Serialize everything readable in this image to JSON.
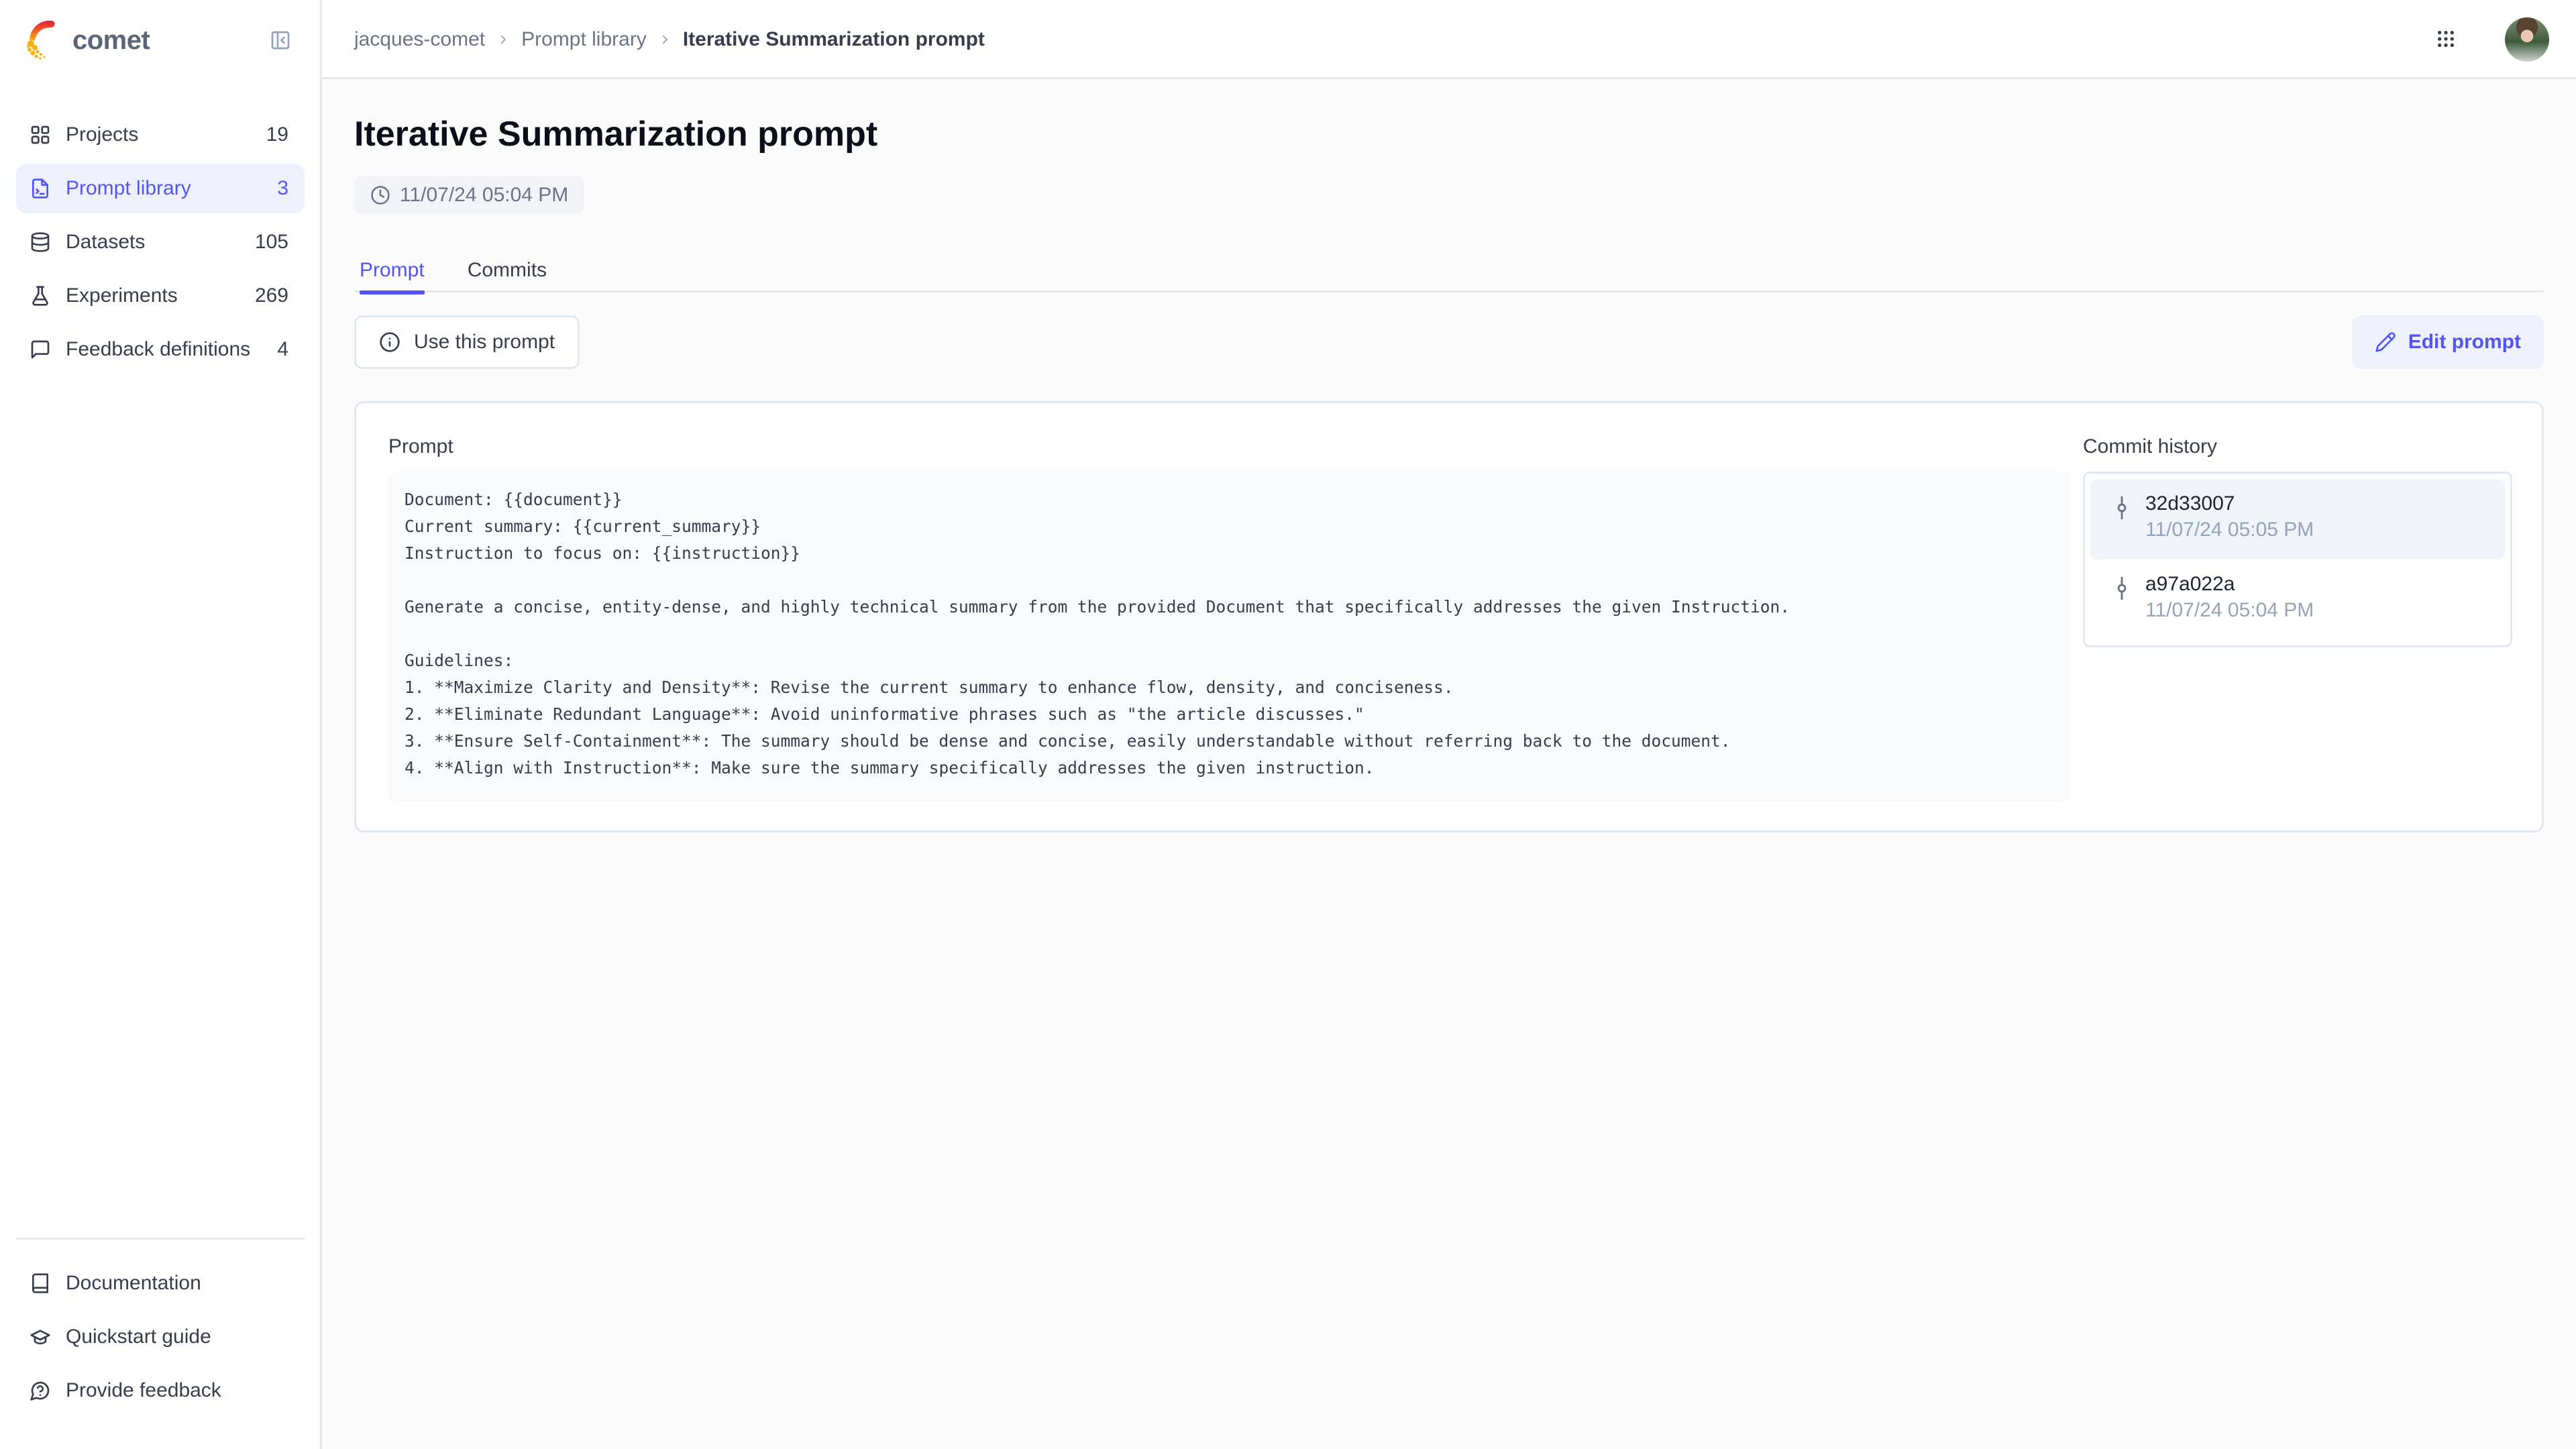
{
  "app": {
    "brand": "comet"
  },
  "sidebar": {
    "items": [
      {
        "id": "projects",
        "label": "Projects",
        "count": "19",
        "icon": "grid-icon",
        "active": false
      },
      {
        "id": "prompt-library",
        "label": "Prompt library",
        "count": "3",
        "icon": "file-terminal-icon",
        "active": true
      },
      {
        "id": "datasets",
        "label": "Datasets",
        "count": "105",
        "icon": "database-icon",
        "active": false
      },
      {
        "id": "experiments",
        "label": "Experiments",
        "count": "269",
        "icon": "flask-icon",
        "active": false
      },
      {
        "id": "feedback-definitions",
        "label": "Feedback definitions",
        "count": "4",
        "icon": "message-square-icon",
        "active": false
      }
    ],
    "bottom_items": [
      {
        "id": "documentation",
        "label": "Documentation",
        "icon": "book-icon"
      },
      {
        "id": "quickstart-guide",
        "label": "Quickstart guide",
        "icon": "graduation-cap-icon"
      },
      {
        "id": "provide-feedback",
        "label": "Provide feedback",
        "icon": "message-circle-question-icon"
      }
    ]
  },
  "header": {
    "breadcrumb": [
      "jacques-comet",
      "Prompt library",
      "Iterative Summarization prompt"
    ]
  },
  "page": {
    "title": "Iterative Summarization prompt",
    "created_at": "11/07/24 05:04 PM",
    "tabs": [
      {
        "label": "Prompt",
        "active": true
      },
      {
        "label": "Commits",
        "active": false
      }
    ],
    "use_prompt_label": "Use this prompt",
    "edit_prompt_label": "Edit prompt",
    "prompt_section_label": "Prompt",
    "prompt_text": "Document: {{document}}\nCurrent summary: {{current_summary}}\nInstruction to focus on: {{instruction}}\n\nGenerate a concise, entity-dense, and highly technical summary from the provided Document that specifically addresses the given Instruction.\n\nGuidelines:\n1. **Maximize Clarity and Density**: Revise the current summary to enhance flow, density, and conciseness.\n2. **Eliminate Redundant Language**: Avoid uninformative phrases such as \"the article discusses.\"\n3. **Ensure Self-Containment**: The summary should be dense and concise, easily understandable without referring back to the document.\n4. **Align with Instruction**: Make sure the summary specifically addresses the given instruction.",
    "commit_history_label": "Commit history",
    "commits": [
      {
        "id": "32d33007",
        "date": "11/07/24 05:05 PM",
        "active": true
      },
      {
        "id": "a97a022a",
        "date": "11/07/24 05:04 PM",
        "active": false
      }
    ]
  },
  "colors": {
    "accent": "#5155f5",
    "accent_soft": "#eff0fd",
    "border": "#e2e8f0",
    "text": "#373d4d",
    "muted": "#94a3b8"
  }
}
